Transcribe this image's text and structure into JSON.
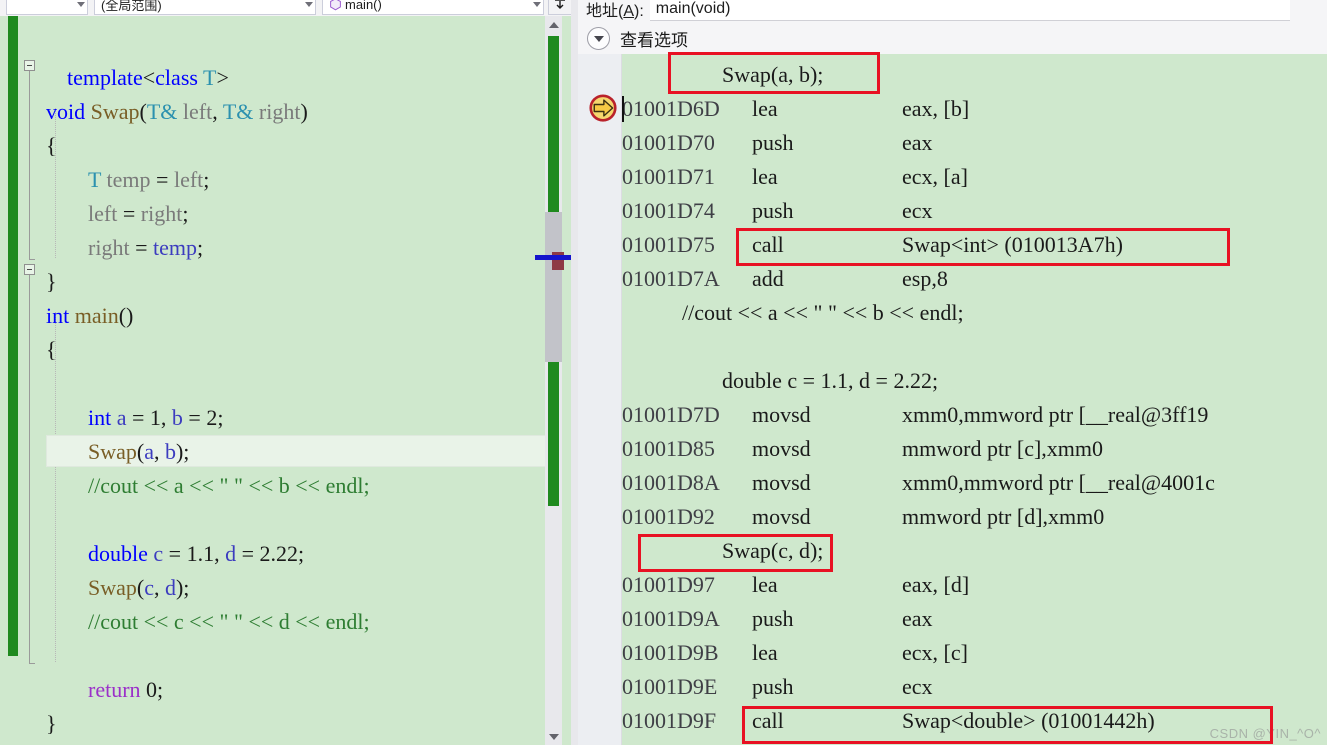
{
  "window": {
    "left_pane_title": "code-editor",
    "right_pane_title": "disassembly"
  },
  "navbar": {
    "project_scope": "",
    "scope_label": "(全局范围)",
    "symbol_label": "main()",
    "icons": {
      "dropdown": "chevron-down-icon",
      "method": "method-hexagon-icon",
      "expand_all": "collapse-all-icon"
    }
  },
  "editor": {
    "current_line_index": 11,
    "lines": [
      {
        "indent": 1,
        "tokens": [
          {
            "t": "kw",
            "v": "template"
          },
          {
            "t": "pun",
            "v": "<"
          },
          {
            "t": "kw",
            "v": "class"
          },
          {
            "t": "pun",
            "v": " "
          },
          {
            "t": "typ",
            "v": "T"
          },
          {
            "t": "pun",
            "v": ">"
          }
        ]
      },
      {
        "indent": 0,
        "tokens": [
          {
            "t": "kw",
            "v": "void"
          },
          {
            "t": "pun",
            "v": " "
          },
          {
            "t": "fn",
            "v": "Swap"
          },
          {
            "t": "pun",
            "v": "("
          },
          {
            "t": "typ",
            "v": "T&"
          },
          {
            "t": "pun",
            "v": " "
          },
          {
            "t": "var",
            "v": "left"
          },
          {
            "t": "pun",
            "v": ", "
          },
          {
            "t": "typ",
            "v": "T&"
          },
          {
            "t": "pun",
            "v": " "
          },
          {
            "t": "var",
            "v": "right"
          },
          {
            "t": "pun",
            "v": ")"
          }
        ]
      },
      {
        "indent": 0,
        "tokens": [
          {
            "t": "pun",
            "v": "{"
          }
        ]
      },
      {
        "indent": 2,
        "tokens": [
          {
            "t": "typ",
            "v": "T"
          },
          {
            "t": "pun",
            "v": " "
          },
          {
            "t": "var",
            "v": "temp"
          },
          {
            "t": "pun",
            "v": " = "
          },
          {
            "t": "var",
            "v": "left"
          },
          {
            "t": "pun",
            "v": ";"
          }
        ]
      },
      {
        "indent": 2,
        "tokens": [
          {
            "t": "var",
            "v": "left"
          },
          {
            "t": "pun",
            "v": " = "
          },
          {
            "t": "var",
            "v": "right"
          },
          {
            "t": "pun",
            "v": ";"
          }
        ]
      },
      {
        "indent": 2,
        "tokens": [
          {
            "t": "var",
            "v": "right"
          },
          {
            "t": "pun",
            "v": " = "
          },
          {
            "t": "loc",
            "v": "temp"
          },
          {
            "t": "pun",
            "v": ";"
          }
        ]
      },
      {
        "indent": 0,
        "tokens": [
          {
            "t": "pun",
            "v": "}"
          }
        ]
      },
      {
        "indent": 0,
        "tokens": [
          {
            "t": "kw",
            "v": "int"
          },
          {
            "t": "pun",
            "v": " "
          },
          {
            "t": "fn",
            "v": "main"
          },
          {
            "t": "pun",
            "v": "()"
          }
        ]
      },
      {
        "indent": 0,
        "tokens": [
          {
            "t": "pun",
            "v": "{"
          }
        ]
      },
      {
        "indent": 2,
        "tokens": []
      },
      {
        "indent": 2,
        "tokens": [
          {
            "t": "kw",
            "v": "int"
          },
          {
            "t": "pun",
            "v": " "
          },
          {
            "t": "loc",
            "v": "a"
          },
          {
            "t": "pun",
            "v": " = "
          },
          {
            "t": "num",
            "v": "1"
          },
          {
            "t": "pun",
            "v": ", "
          },
          {
            "t": "loc",
            "v": "b"
          },
          {
            "t": "pun",
            "v": " = "
          },
          {
            "t": "num",
            "v": "2"
          },
          {
            "t": "pun",
            "v": ";"
          }
        ]
      },
      {
        "indent": 2,
        "tokens": [
          {
            "t": "fn",
            "v": "Swap"
          },
          {
            "t": "pun",
            "v": "("
          },
          {
            "t": "loc",
            "v": "a"
          },
          {
            "t": "pun",
            "v": ", "
          },
          {
            "t": "loc",
            "v": "b"
          },
          {
            "t": "pun",
            "v": ");"
          }
        ]
      },
      {
        "indent": 2,
        "tokens": [
          {
            "t": "cmt",
            "v": "//cout << a << \" \" << b << endl;"
          }
        ]
      },
      {
        "indent": 2,
        "tokens": []
      },
      {
        "indent": 2,
        "tokens": [
          {
            "t": "kw",
            "v": "double"
          },
          {
            "t": "pun",
            "v": " "
          },
          {
            "t": "loc",
            "v": "c"
          },
          {
            "t": "pun",
            "v": " = "
          },
          {
            "t": "num",
            "v": "1.1"
          },
          {
            "t": "pun",
            "v": ", "
          },
          {
            "t": "loc",
            "v": "d"
          },
          {
            "t": "pun",
            "v": " = "
          },
          {
            "t": "num",
            "v": "2.22"
          },
          {
            "t": "pun",
            "v": ";"
          }
        ]
      },
      {
        "indent": 2,
        "tokens": [
          {
            "t": "fn",
            "v": "Swap"
          },
          {
            "t": "pun",
            "v": "("
          },
          {
            "t": "loc",
            "v": "c"
          },
          {
            "t": "pun",
            "v": ", "
          },
          {
            "t": "loc",
            "v": "d"
          },
          {
            "t": "pun",
            "v": ");"
          }
        ]
      },
      {
        "indent": 2,
        "tokens": [
          {
            "t": "cmt",
            "v": "//cout << c << \" \" << d << endl;"
          }
        ]
      },
      {
        "indent": 2,
        "tokens": []
      },
      {
        "indent": 2,
        "tokens": [
          {
            "t": "ctl",
            "v": "return"
          },
          {
            "t": "pun",
            "v": " "
          },
          {
            "t": "num",
            "v": "0"
          },
          {
            "t": "pun",
            "v": ";"
          }
        ]
      },
      {
        "indent": 0,
        "tokens": [
          {
            "t": "pun",
            "v": "}"
          }
        ]
      }
    ],
    "scrollbar": {
      "up_icon": "scroll-up-arrow-icon",
      "down_icon": "scroll-down-arrow-icon"
    }
  },
  "disassembly": {
    "address_label": "地址(A):",
    "address_label_pre": "地址(",
    "address_label_key": "A",
    "address_label_post": "):",
    "address_value": "main(void)",
    "view_options_label": "查看选项",
    "current_instruction_address": "01001D6D",
    "lines": [
      {
        "kind": "source",
        "text": "Swap(a, b);",
        "indent": 100
      },
      {
        "kind": "asm",
        "addr": "01001D6D",
        "mnemonic": "lea",
        "operands": "eax, [b]",
        "current": true
      },
      {
        "kind": "asm",
        "addr": "01001D70",
        "mnemonic": "push",
        "operands": "eax"
      },
      {
        "kind": "asm",
        "addr": "01001D71",
        "mnemonic": "lea",
        "operands": "ecx, [a]"
      },
      {
        "kind": "asm",
        "addr": "01001D74",
        "mnemonic": "push",
        "operands": "ecx"
      },
      {
        "kind": "asm",
        "addr": "01001D75",
        "mnemonic": "call",
        "operands": "Swap<int> (010013A7h)"
      },
      {
        "kind": "asm",
        "addr": "01001D7A",
        "mnemonic": "add",
        "operands": "esp,8"
      },
      {
        "kind": "source",
        "text": "//cout << a << \" \" << b << endl;",
        "indent": 60
      },
      {
        "kind": "blank"
      },
      {
        "kind": "source",
        "text": "double c = 1.1, d = 2.22;",
        "indent": 100
      },
      {
        "kind": "asm",
        "addr": "01001D7D",
        "mnemonic": "movsd",
        "operands": "xmm0,mmword ptr [__real@3ff19"
      },
      {
        "kind": "asm",
        "addr": "01001D85",
        "mnemonic": "movsd",
        "operands": "mmword ptr [c],xmm0"
      },
      {
        "kind": "asm",
        "addr": "01001D8A",
        "mnemonic": "movsd",
        "operands": "xmm0,mmword ptr [__real@4001c"
      },
      {
        "kind": "asm",
        "addr": "01001D92",
        "mnemonic": "movsd",
        "operands": "mmword ptr [d],xmm0"
      },
      {
        "kind": "source",
        "text": "Swap(c, d);",
        "indent": 100
      },
      {
        "kind": "asm",
        "addr": "01001D97",
        "mnemonic": "lea",
        "operands": "eax, [d]"
      },
      {
        "kind": "asm",
        "addr": "01001D9A",
        "mnemonic": "push",
        "operands": "eax"
      },
      {
        "kind": "asm",
        "addr": "01001D9B",
        "mnemonic": "lea",
        "operands": "ecx, [c]"
      },
      {
        "kind": "asm",
        "addr": "01001D9E",
        "mnemonic": "push",
        "operands": "ecx"
      },
      {
        "kind": "asm",
        "addr": "01001D9F",
        "mnemonic": "call",
        "operands": "Swap<double> (01001442h)"
      }
    ],
    "annotations": [
      {
        "name": "highlight-swap-a-b",
        "label": "Swap(a, b);"
      },
      {
        "name": "highlight-call-swap-int",
        "label": "call Swap<int> (010013A7h)"
      },
      {
        "name": "highlight-swap-c-d",
        "label": "Swap(c, d);"
      },
      {
        "name": "highlight-call-swap-double",
        "label": "call Swap<double> (01001442h)"
      }
    ],
    "icons": {
      "current_instruction": "current-instruction-arrow-icon",
      "view_options_chevron": "chevron-down-circle-icon"
    }
  },
  "watermark": "CSDN @YIN_^O^",
  "colors": {
    "editor_background": "#cfe8cd",
    "annotation_red": "#e81123",
    "changed_lines_green": "#1f8a1f",
    "keyword_blue": "#0000ff",
    "type_teal": "#2b91af",
    "function_gold": "#795e26",
    "comment_green": "#2e7d32",
    "control_purple": "#9b30c9"
  }
}
